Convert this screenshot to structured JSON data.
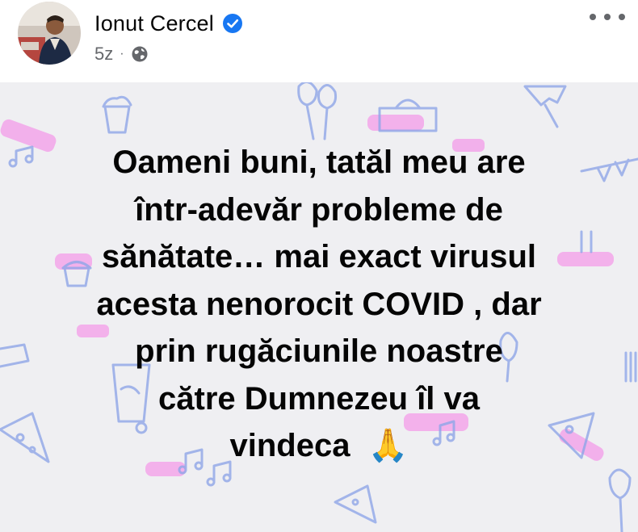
{
  "post": {
    "author": {
      "name": "Ionut Cercel",
      "verified": true,
      "avatar_icon": "profile-photo"
    },
    "timestamp": "5z",
    "separator": "·",
    "audience_icon": "globe-icon",
    "more_icon": "more-dots-icon",
    "text": "Oameni buni, tatăl meu are\nîntr-adevăr probleme de\nsănătate… mai exact virusul\nacesta nenorocit COVID , dar\nprin rugăciunile noastre\ncătre Dumnezeu îl va\nvindeca",
    "emoji": "🙏",
    "background": {
      "color": "#efeff2",
      "theme": "party",
      "accent_pink": "#f06ad6",
      "accent_blue": "#8fa6e8"
    }
  },
  "colors": {
    "verified_blue": "#1877f2",
    "meta_gray": "#65676b",
    "text_dark": "#050505"
  }
}
